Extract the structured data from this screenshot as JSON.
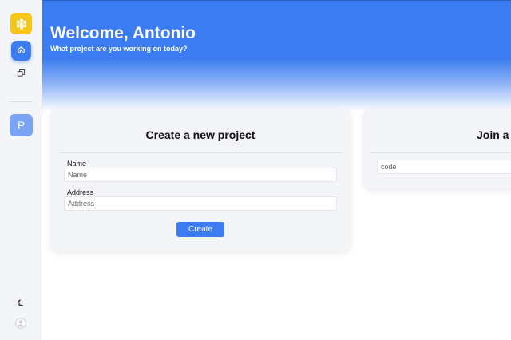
{
  "header": {
    "title": "Welcome, Antonio",
    "subtitle": "What project are you working on today?"
  },
  "sidebar": {
    "project_initial": "P"
  },
  "create_card": {
    "title": "Create a new project",
    "name_label": "Name",
    "name_placeholder": "Name",
    "address_label": "Address",
    "address_placeholder": "Address",
    "create_label": "Create"
  },
  "join_card": {
    "title": "Join a",
    "code_placeholder": "code"
  },
  "colors": {
    "accent": "#3b7cf0",
    "logo": "#f5c518"
  },
  "icons": [
    "logo-icon",
    "home-icon",
    "projects-icon",
    "moon-icon",
    "user-icon"
  ]
}
